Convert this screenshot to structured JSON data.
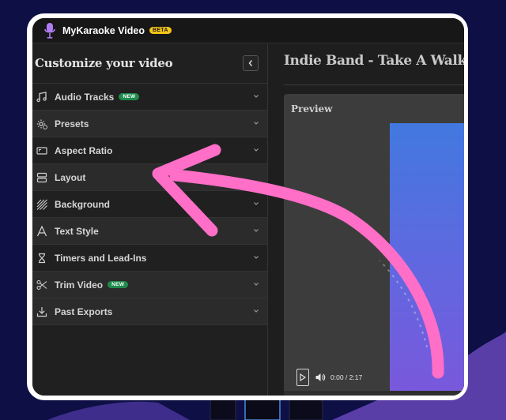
{
  "app": {
    "title": "MyKaraoke Video",
    "beta_badge": "BETA"
  },
  "sidebar": {
    "title": "Customize your video",
    "items": [
      {
        "label": "Audio Tracks",
        "badge": "NEW",
        "icon": "music-note-icon"
      },
      {
        "label": "Presets",
        "icon": "gear-presets-icon"
      },
      {
        "label": "Aspect Ratio",
        "icon": "aspect-ratio-icon"
      },
      {
        "label": "Layout",
        "icon": "layout-icon"
      },
      {
        "label": "Background",
        "icon": "background-stripes-icon"
      },
      {
        "label": "Text Style",
        "icon": "text-style-icon"
      },
      {
        "label": "Timers and Lead-Ins",
        "icon": "hourglass-icon"
      },
      {
        "label": "Trim Video",
        "badge": "NEW",
        "icon": "scissors-icon"
      },
      {
        "label": "Past Exports",
        "icon": "download-icon"
      }
    ]
  },
  "main": {
    "title": "Indie Band - Take A Walk",
    "preview_label": "Preview",
    "player": {
      "time": "0:00 / 2:17"
    }
  },
  "colors": {
    "page_background": "#0d0f45",
    "accent_arrow": "#ff6ec7",
    "beta_badge": "#f5c518",
    "new_badge": "#1f8a4c",
    "video_gradient_top": "#4278e0",
    "video_gradient_bottom": "#7a58dc"
  }
}
